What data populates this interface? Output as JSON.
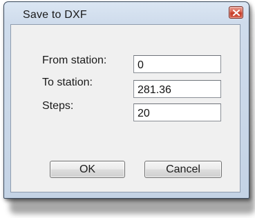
{
  "window": {
    "title": "Save to DXF"
  },
  "icons": {
    "close": "close-icon"
  },
  "form": {
    "from_station": {
      "label": "From station:",
      "value": "0"
    },
    "to_station": {
      "label": "To station:",
      "value": "281.36"
    },
    "steps": {
      "label": "Steps:",
      "value": "20"
    }
  },
  "buttons": {
    "ok": "OK",
    "cancel": "Cancel"
  },
  "colors": {
    "close_button": "#d8624f",
    "window_frame": "#cfdcec",
    "client_background": "#f0f0f0"
  }
}
